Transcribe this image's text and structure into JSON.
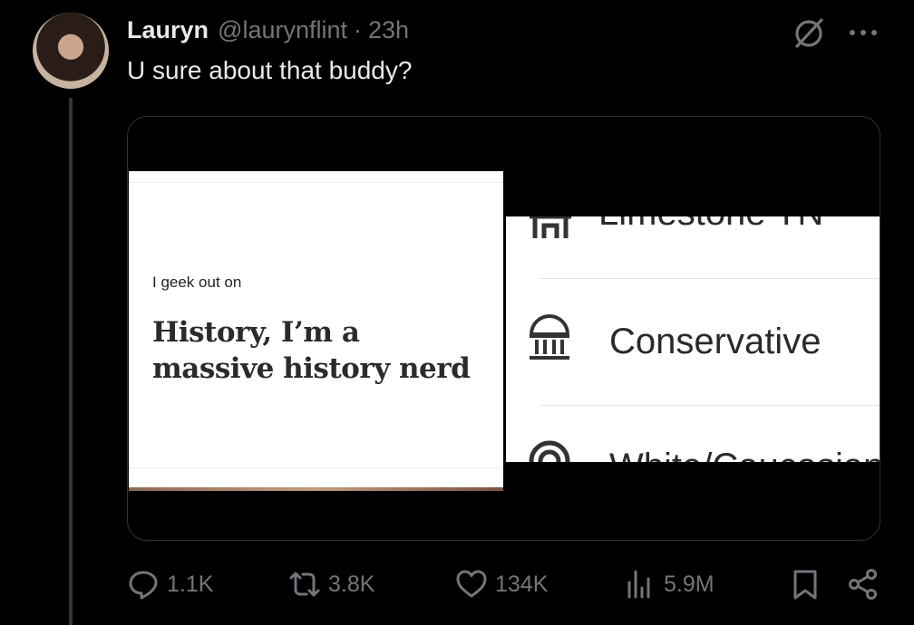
{
  "tweet": {
    "author_name": "Lauryn",
    "author_handle": "@laurynflint",
    "separator": "·",
    "time": "23h",
    "text": "U sure about that buddy?"
  },
  "media": {
    "left_image": {
      "label": "I geek out on",
      "value_line1": "History, I’m a",
      "value_line2": "massive history nerd"
    },
    "right_image": {
      "rows": [
        {
          "icon": "hometown-icon",
          "text": "Limestone TN"
        },
        {
          "icon": "politics-icon",
          "text": "Conservative"
        },
        {
          "icon": "ethnicity-icon",
          "text": "White/Caucasian"
        }
      ]
    }
  },
  "actions": {
    "reply_count": "1.1K",
    "repost_count": "3.8K",
    "like_count": "134K",
    "views_count": "5.9M"
  },
  "colors": {
    "background": "#000000",
    "text_primary": "#e7e9ea",
    "text_secondary": "#71767b",
    "border": "#2f3336"
  }
}
